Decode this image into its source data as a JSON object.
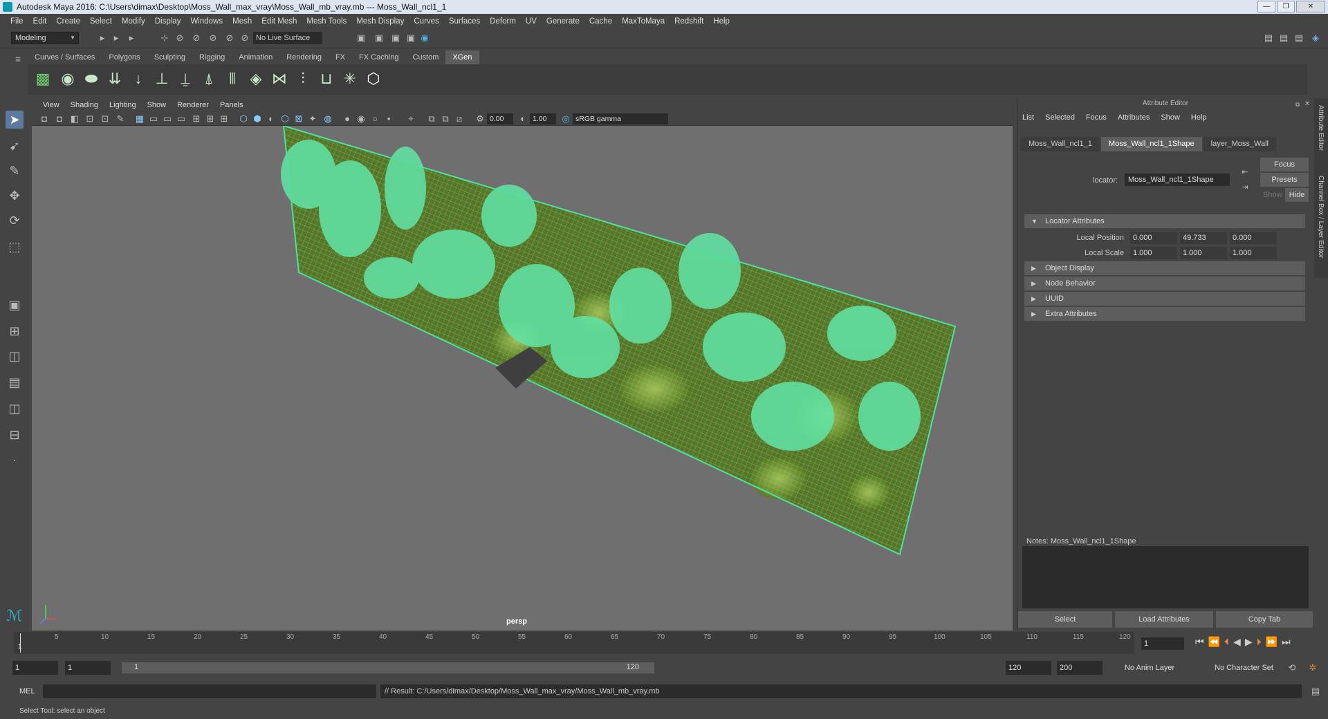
{
  "window": {
    "title": "Autodesk Maya 2016: C:\\Users\\dimax\\Desktop\\Moss_Wall_max_vray\\Moss_Wall_mb_vray.mb   ---   Moss_Wall_ncl1_1",
    "minimize": "—",
    "maximize": "❐",
    "close": "✕"
  },
  "menubar": [
    "File",
    "Edit",
    "Create",
    "Select",
    "Modify",
    "Display",
    "Windows",
    "Mesh",
    "Edit Mesh",
    "Mesh Tools",
    "Mesh Display",
    "Curves",
    "Surfaces",
    "Deform",
    "UV",
    "Generate",
    "Cache",
    "MaxToMaya",
    "Redshift",
    "Help"
  ],
  "toolbar": {
    "mode": "Modeling",
    "live_surface": "No Live Surface"
  },
  "shelf": {
    "tabs": [
      "Curves / Surfaces",
      "Polygons",
      "Sculpting",
      "Rigging",
      "Animation",
      "Rendering",
      "FX",
      "FX Caching",
      "Custom",
      "XGen"
    ],
    "active_tab": "XGen"
  },
  "viewport": {
    "menu": [
      "View",
      "Shading",
      "Lighting",
      "Show",
      "Renderer",
      "Panels"
    ],
    "exposure": "0.00",
    "gamma": "1.00",
    "color_space": "sRGB gamma",
    "camera": "persp"
  },
  "attribute_editor": {
    "title": "Attribute Editor",
    "menu": [
      "List",
      "Selected",
      "Focus",
      "Attributes",
      "Show",
      "Help"
    ],
    "tabs": [
      "Moss_Wall_ncl1_1",
      "Moss_Wall_ncl1_1Shape",
      "layer_Moss_Wall"
    ],
    "active_tab": "Moss_Wall_ncl1_1Shape",
    "locator_label": "locator:",
    "locator_value": "Moss_Wall_ncl1_1Shape",
    "focus_btn": "Focus",
    "presets_btn": "Presets",
    "show_btn": "Show",
    "hide_btn": "Hide",
    "sections": {
      "locator_attributes": "Locator Attributes",
      "object_display": "Object Display",
      "node_behavior": "Node Behavior",
      "uuid": "UUID",
      "extra_attributes": "Extra Attributes"
    },
    "local_position": {
      "label": "Local Position",
      "x": "0.000",
      "y": "49.733",
      "z": "0.000"
    },
    "local_scale": {
      "label": "Local Scale",
      "x": "1.000",
      "y": "1.000",
      "z": "1.000"
    },
    "notes_label": "Notes:  Moss_Wall_ncl1_1Shape",
    "select_btn": "Select",
    "load_btn": "Load Attributes",
    "copy_btn": "Copy Tab",
    "side_tabs": [
      "Attribute Editor",
      "Channel Box / Layer Editor"
    ]
  },
  "timeline": {
    "ticks": [
      "5",
      "10",
      "15",
      "20",
      "25",
      "30",
      "35",
      "40",
      "45",
      "50",
      "55",
      "60",
      "65",
      "70",
      "75",
      "80",
      "85",
      "90",
      "95",
      "100",
      "105",
      "110",
      "115",
      "120"
    ],
    "start_label": "1",
    "current_frame": "1"
  },
  "range": {
    "start": "1",
    "playback_start": "1",
    "slider_start": "1",
    "slider_end": "120",
    "playback_end": "120",
    "end": "200",
    "anim_layer": "No Anim Layer",
    "character_set": "No Character Set"
  },
  "command_line": {
    "lang": "MEL",
    "result": "// Result: C:/Users/dimax/Desktop/Moss_Wall_max_vray/Moss_Wall_mb_vray.mb"
  },
  "help_line": "Select Tool: select an object",
  "colors": {
    "wire": "#4fe0a0",
    "moss": "#6d8a2a",
    "selection": "#5c7aa0"
  }
}
